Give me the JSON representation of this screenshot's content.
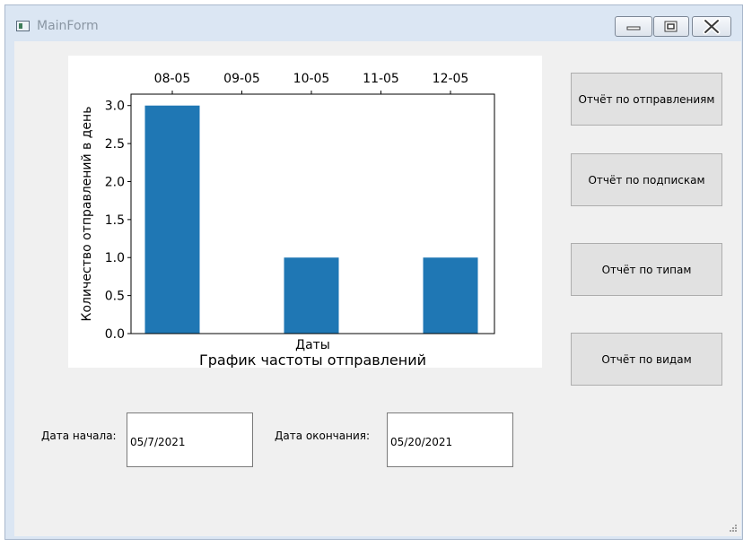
{
  "window": {
    "title": "MainForm",
    "icons": {
      "app": "app-window-icon",
      "minimize": "minimize-icon",
      "maximize": "maximize-icon",
      "close": "close-icon"
    }
  },
  "buttons": {
    "report_sends": "Отчёт по отправлениям",
    "report_subscriptions": "Отчёт по подпискам",
    "report_types": "Отчёт по типам",
    "report_kinds": "Отчёт по видам"
  },
  "dates": {
    "start_label": "Дата начала:",
    "start_value": "05/7/2021",
    "end_label": "Дата окончания:",
    "end_value": "05/20/2021"
  },
  "chart_data": {
    "type": "bar",
    "title": "График частоты отправлений",
    "xlabel": "Даты",
    "ylabel": "Количество отправлений в день",
    "x": [
      "08-05",
      "10-05",
      "12-05"
    ],
    "values": [
      3,
      1,
      1
    ],
    "x_ticks": [
      "08-05",
      "09-05",
      "10-05",
      "11-05",
      "12-05"
    ],
    "x_tick_position": "top",
    "y_ticks": [
      "0.0",
      "0.5",
      "1.0",
      "1.5",
      "2.0",
      "2.5",
      "3.0"
    ],
    "ylim": [
      0,
      3.15
    ],
    "bar_color": "#1f77b4",
    "grid": false
  }
}
